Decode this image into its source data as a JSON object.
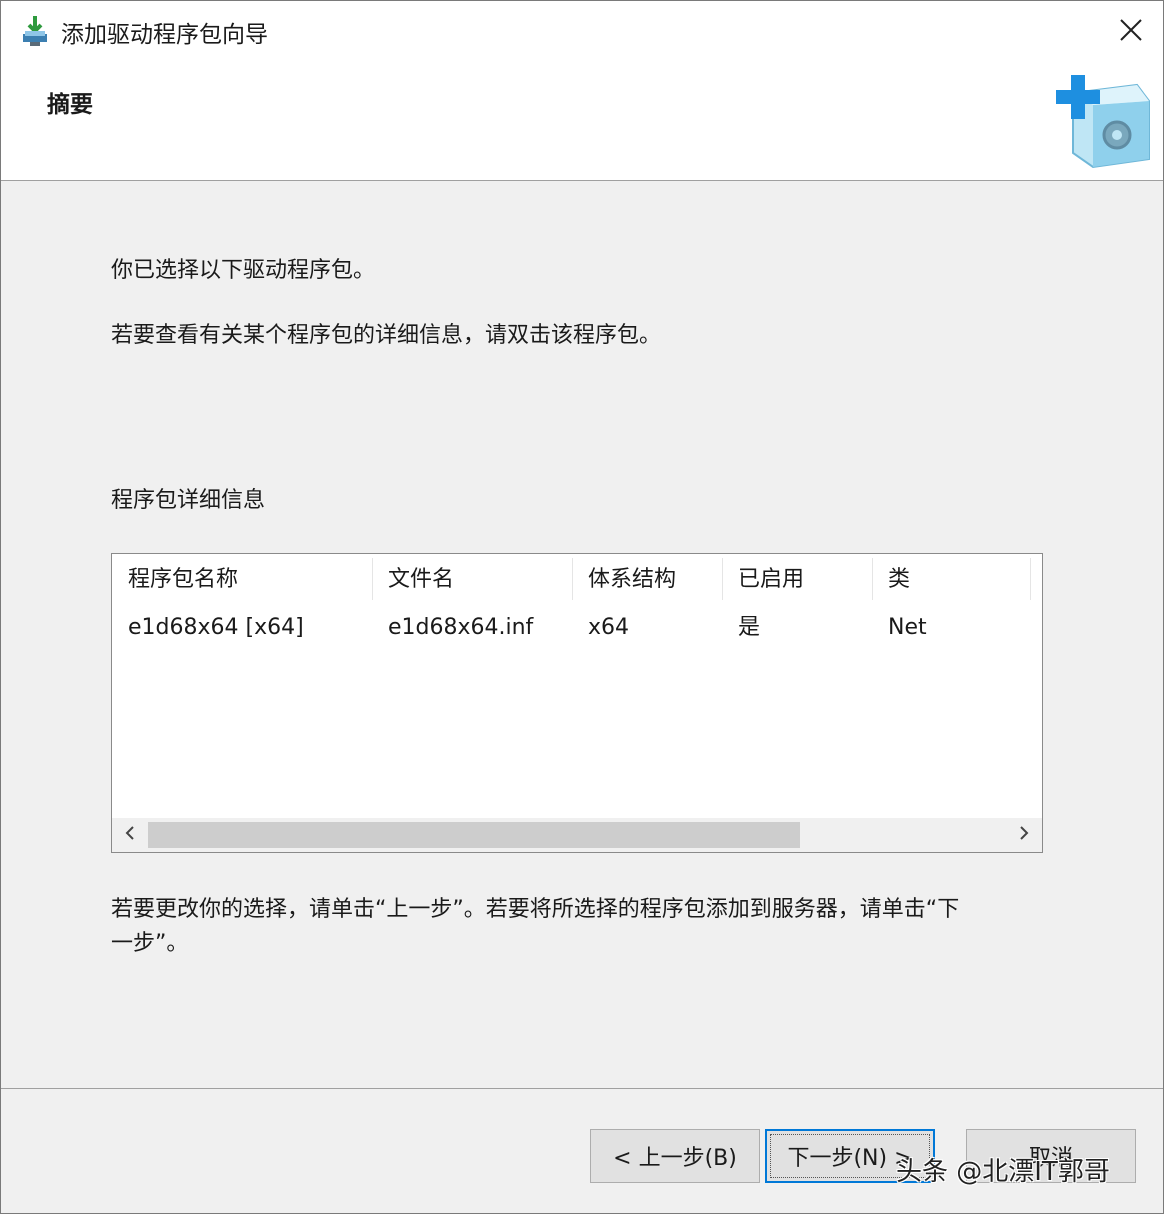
{
  "window": {
    "title": "添加驱动程序包向导"
  },
  "header": {
    "title": "摘要"
  },
  "content": {
    "intro": "你已选择以下驱动程序包。",
    "hint": "若要查看有关某个程序包的详细信息，请双击该程序包。",
    "details_label": "程序包详细信息",
    "footer_line1": "若要更改你的选择，请单击“上一步”。若要将所选择的程序包添加到服务器，请单击“下",
    "footer_line2": "一步”。"
  },
  "table": {
    "columns": [
      "程序包名称",
      "文件名",
      "体系结构",
      "已启用",
      "类"
    ],
    "rows": [
      [
        "e1d68x64 [x64]",
        "e1d68x64.inf",
        "x64",
        "是",
        "Net"
      ]
    ]
  },
  "buttons": {
    "back": "< 上一步(B)",
    "next": "下一步(N) >",
    "cancel": "取消"
  },
  "watermark": "头条 @北漂IT郭哥",
  "colors": {
    "primary_border": "#0078d7",
    "header_bg": "#ffffff",
    "body_bg": "#f0f0f0"
  },
  "icons": {
    "title": "driver-package-icon",
    "wizard": "add-package-cube-icon"
  }
}
